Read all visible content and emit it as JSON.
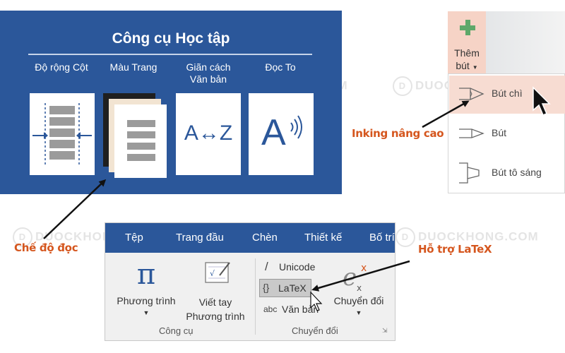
{
  "learning_tools": {
    "title": "Công cụ Học tập",
    "tools": [
      {
        "label": "Độ rộng Cột"
      },
      {
        "label": "Màu Trang"
      },
      {
        "label_line1": "Giãn cách",
        "label_line2": "Văn bản",
        "card_text": "A↔Z"
      },
      {
        "label": "Đọc To",
        "card_text": "A"
      }
    ]
  },
  "pen_panel": {
    "add_pen_line1": "Thêm",
    "add_pen_line2": "bút",
    "items": [
      "Bút chì",
      "Bút",
      "Bút tô sáng"
    ]
  },
  "ribbon": {
    "tabs": [
      "Tệp",
      "Trang đầu",
      "Chèn",
      "Thiết kế",
      "Bố trí"
    ],
    "equation_symbol": "π",
    "equation_label": "Phương trình",
    "ink_line1": "Viết tay",
    "ink_line2": "Phương trình",
    "unicode_label": "Unicode",
    "latex_label": "LaTeX",
    "text_label": "Văn bản",
    "convert_label": "Chuyển đổi",
    "group_tools": "Công cụ",
    "group_convert": "Chuyển đổi",
    "abc": "abc",
    "slash": "/",
    "braces": "{}"
  },
  "callouts": {
    "inking": "Inking nâng cao",
    "reading": "Chế độ đọc",
    "latex": "Hỗ trợ LaTeX"
  },
  "watermark": {
    "letter": "D",
    "text": "DUOCKHONG.COM"
  },
  "colors": {
    "ribbon_blue": "#2b579a",
    "callout_orange": "#d5561e",
    "add_pen_bg": "#f6d3c6",
    "plus_green": "#5ea86a"
  }
}
